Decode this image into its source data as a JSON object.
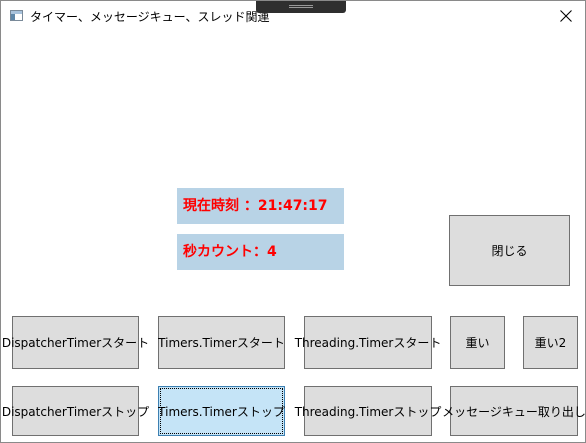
{
  "window": {
    "title": "タイマー、メッセージキュー、スレッド関連"
  },
  "info": {
    "time_text": "現在時刻 ：21:47:17",
    "count_text": "秒カウント：4"
  },
  "buttons": {
    "close": "閉じる",
    "dispatcher_start": "DispatcherTimerスタート",
    "timers_start": "Timers.Timerスタート",
    "threading_start": "Threading.Timerスタート",
    "heavy1": "重い",
    "heavy2": "重い2",
    "dispatcher_stop": "DispatcherTimerストップ",
    "timers_stop": "Timers.Timerストップ",
    "threading_stop": "Threading.Timerストップ",
    "message_queue": "メッセージキュー取り出し"
  },
  "colors": {
    "info_background": "#b8d3e6",
    "info_text": "#ff0000",
    "button_background": "#dddddd",
    "focused_button_background": "#c5e4f7"
  }
}
